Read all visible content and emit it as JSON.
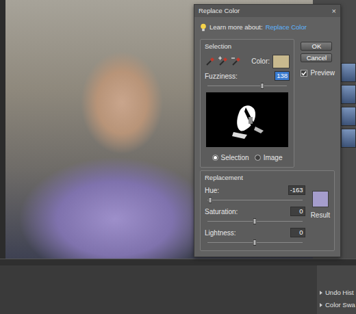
{
  "window": {
    "title": "Replace Color",
    "close": "×"
  },
  "learn_more": {
    "prefix": "Learn more about:",
    "link": "Replace Color"
  },
  "buttons": [
    {
      "label": "OK"
    },
    {
      "label": "Cancel"
    }
  ],
  "preview": {
    "label": "Preview",
    "checked": true
  },
  "selection": {
    "title": "Selection",
    "color_label": "Color:",
    "color": "#c8b98e",
    "fuzziness": {
      "label": "Fuzziness:",
      "value": "138",
      "level": 0.69,
      "highlighted": true
    },
    "views": [
      {
        "label": "Selection",
        "selected": true
      },
      {
        "label": "Image",
        "selected": false
      }
    ]
  },
  "replacement": {
    "title": "Replacement",
    "sliders": [
      {
        "label": "Hue:",
        "value": "-163",
        "level": 0.03
      },
      {
        "label": "Saturation:",
        "value": "0",
        "level": 0.5
      },
      {
        "label": "Lightness:",
        "value": "0",
        "level": 0.5
      }
    ],
    "result_label": "Result",
    "result_color": "#a59dcc"
  },
  "panels": [
    {
      "label": "Undo Hist"
    },
    {
      "label": "Color Swa"
    }
  ]
}
